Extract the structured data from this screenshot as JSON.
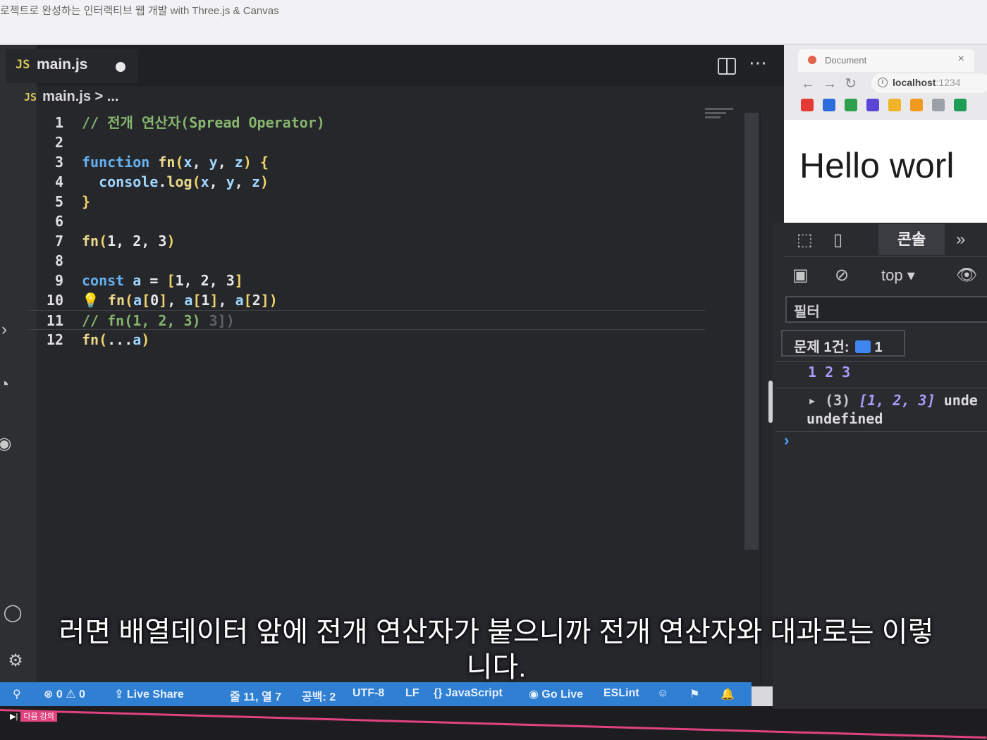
{
  "course_title": "로젝트로 완성하는 인터랙티브 웹 개발 with Three.js & Canvas",
  "editor": {
    "tab_name": "main.js",
    "tab_lang": "JS",
    "breadcrumb_file": "main.js",
    "breadcrumb_more": "> ..."
  },
  "browser": {
    "tab_title": "Document",
    "tab_close": "×",
    "url_host": "localhost",
    "url_port": ":1234",
    "page_heading": "Hello worl"
  },
  "devtools": {
    "console_tab": "콘솔",
    "more_tabs": "»",
    "context": "top ▾",
    "filter_placeholder": "필터",
    "issues_label": "문제 1건:",
    "issues_count": "1",
    "log1": "1 2 3",
    "log2_prefix": "▸ (3)",
    "log2_array": "[1, 2, 3]",
    "log2_suffix": "unde",
    "log2_line2": "undefined",
    "prompt": "›"
  },
  "statusbar": {
    "problems": "⊗ 0 ⚠ 0",
    "live_share": "Live Share",
    "position": "줄 11, 열 7",
    "spaces": "공백: 2",
    "encoding": "UTF-8",
    "eol": "LF",
    "language": "{} JavaScript",
    "go_live": "Go Live",
    "eslint": "ESLint"
  },
  "player": {
    "next_label": "다음 강의"
  },
  "subtitle": "러면 배열데이터 앞에 전개 연산자가 붙으니까 전개 연산자와 대과로는 이렇\n니다.",
  "colors": {
    "statusbar": "#2f7fd3",
    "editor_bg": "#26272b",
    "keyword": "#65b2f2",
    "comment": "#86b66e"
  }
}
